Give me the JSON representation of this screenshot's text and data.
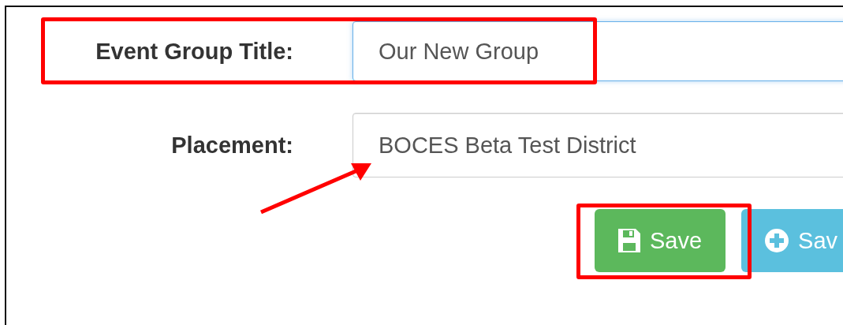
{
  "form": {
    "fields": [
      {
        "label": "Event Group Title:",
        "value": "Our New Group",
        "focused": true
      },
      {
        "label": "Placement:",
        "value": "BOCES Beta Test District",
        "focused": false
      }
    ],
    "buttons": [
      {
        "kind": "save",
        "label": "Save"
      },
      {
        "kind": "add",
        "label": "Sav"
      }
    ]
  }
}
